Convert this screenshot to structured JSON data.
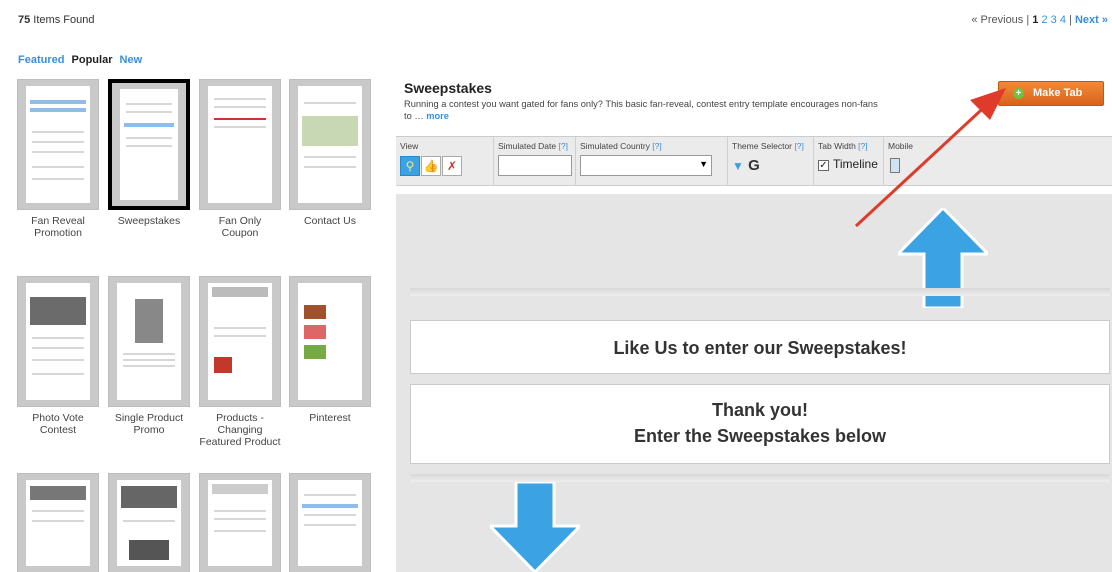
{
  "header": {
    "count": "75",
    "count_suffix": " Items Found",
    "prev": "« Previous",
    "sep": "|",
    "pages": [
      "1",
      "2",
      "3",
      "4"
    ],
    "next": "Next »"
  },
  "filters": [
    "Featured",
    "Popular",
    "New"
  ],
  "templates": [
    {
      "label": "Fan Reveal Promotion"
    },
    {
      "label": "Sweepstakes"
    },
    {
      "label": "Fan Only Coupon"
    },
    {
      "label": "Contact Us"
    },
    {
      "label": "Photo Vote Contest"
    },
    {
      "label": "Single Product Promo"
    },
    {
      "label": "Products - Changing Featured Product"
    },
    {
      "label": "Pinterest"
    },
    {
      "label": ""
    },
    {
      "label": ""
    },
    {
      "label": ""
    },
    {
      "label": ""
    }
  ],
  "detail": {
    "title": "Sweepstakes",
    "description": "Running a contest you want gated for fans only? This basic fan-reveal, contest entry template encourages non-fans to …",
    "more": "more",
    "make_tab": "Make Tab"
  },
  "toolbar": {
    "view": "View",
    "sim_date": "Simulated Date",
    "sim_country": "Simulated Country",
    "q": "[?]",
    "theme": "Theme Selector",
    "theme_letter": "G",
    "tab_width": "Tab Width",
    "timeline": "Timeline",
    "mobile": "Mobile"
  },
  "preview": {
    "like": "Like Us to enter our Sweepstakes!",
    "thanks1": "Thank you!",
    "thanks2": "Enter the Sweepstakes below"
  },
  "colors": {
    "accent": "#3a8ed8",
    "make_tab": "#e8792a",
    "arrow": "#3ba3e3",
    "red": "#e03a2a"
  }
}
